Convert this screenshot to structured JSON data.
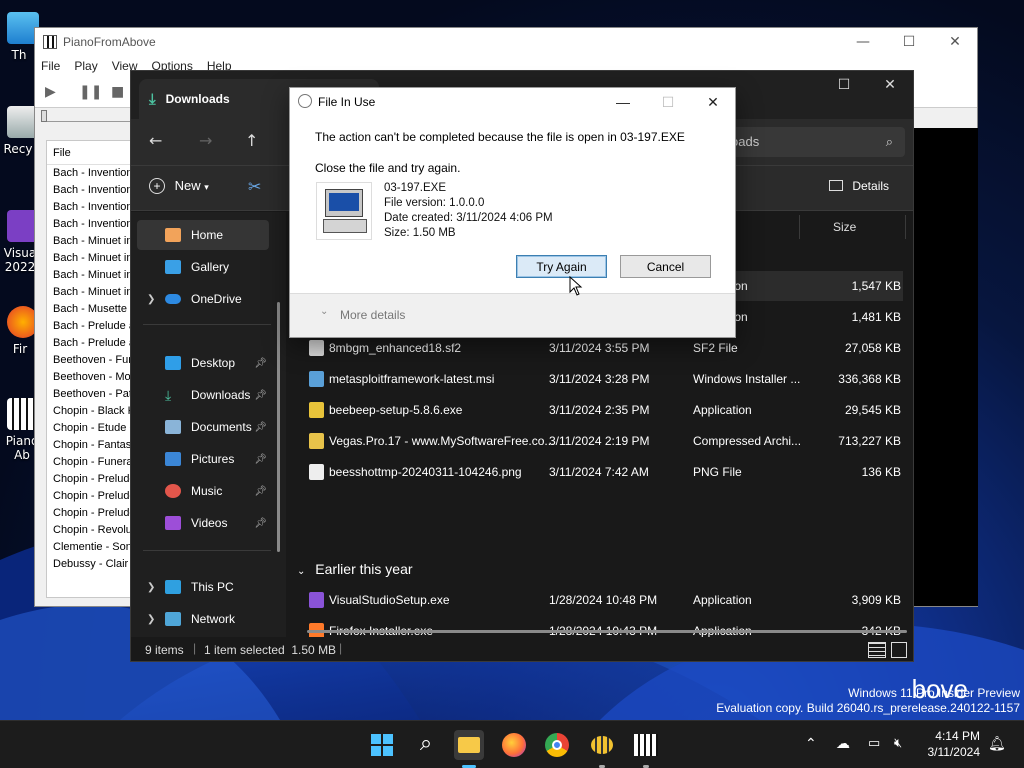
{
  "desktop": {
    "icons": [
      {
        "label": "Th",
        "icon": "this-pc-icon"
      },
      {
        "label": "Recy",
        "icon": "recycle-bin-icon"
      },
      {
        "label": "Visua\n2022",
        "icon": "visual-studio-icon"
      },
      {
        "label": "Fir",
        "icon": "firefox-icon"
      },
      {
        "label": "Piano\nAb",
        "icon": "piano-icon"
      }
    ],
    "watermark_line1": "Windows 11 Pro Insider Preview",
    "watermark_line2": "Evaluation copy. Build 26040.rs_prerelease.240122-1157"
  },
  "piano": {
    "title": "PianoFromAbove",
    "menu": [
      "File",
      "Play",
      "View",
      "Options",
      "Help"
    ],
    "list_header": "File",
    "files": [
      "Bach - Invention",
      "Bach - Invention",
      "Bach - Invention",
      "Bach - Invention",
      "Bach - Minuet in",
      "Bach - Minuet in",
      "Bach - Minuet in",
      "Bach - Minuet in",
      "Bach - Musette i",
      "Bach - Prelude a",
      "Bach - Prelude a",
      "Beethoven - Fur",
      "Beethoven - Mo",
      "Beethoven - Pat",
      "Chopin - Black K",
      "Chopin - Etude C",
      "Chopin - Fantasi",
      "Chopin - Funera",
      "Chopin - Prelude",
      "Chopin - Prelude",
      "Chopin - Prelude",
      "Chopin - Revolu",
      "Clementie - Sona",
      "Debussy - Clair c"
    ],
    "brand_text": "bove"
  },
  "explorer": {
    "tab_title": "Downloads",
    "search_placeholder": "oads",
    "new_label": "New",
    "details_label": "Details",
    "sidebar": {
      "home": "Home",
      "gallery": "Gallery",
      "onedrive": "OneDrive",
      "desktop": "Desktop",
      "downloads": "Downloads",
      "documents": "Documents",
      "pictures": "Pictures",
      "music": "Music",
      "videos": "Videos",
      "thispc": "This PC",
      "network": "Network"
    },
    "col_size": "Size",
    "rows_partial": [
      {
        "type": "ication",
        "size": "1,547 KB"
      },
      {
        "type": "ication",
        "size": "1,481 KB"
      }
    ],
    "rows": [
      {
        "name": "8mbgm_enhanced18.sf2",
        "date": "3/11/2024 3:55 PM",
        "type": "SF2 File",
        "size": "27,058 KB",
        "icon": "sf2-file-icon"
      },
      {
        "name": "metasploitframework-latest.msi",
        "date": "3/11/2024 3:28 PM",
        "type": "Windows Installer ...",
        "size": "336,368 KB",
        "icon": "msi-icon"
      },
      {
        "name": "beebeep-setup-5.8.6.exe",
        "date": "3/11/2024 2:35 PM",
        "type": "Application",
        "size": "29,545 KB",
        "icon": "beebeep-icon"
      },
      {
        "name": "Vegas.Pro.17 - www.MySoftwareFree.co...",
        "date": "3/11/2024 2:19 PM",
        "type": "Compressed Archi...",
        "size": "713,227 KB",
        "icon": "zip-folder-icon"
      },
      {
        "name": "beesshottmp-20240311-104246.png",
        "date": "3/11/2024 7:42 AM",
        "type": "PNG File",
        "size": "136 KB",
        "icon": "png-file-icon"
      }
    ],
    "group_earlier": "Earlier this year",
    "rows_earlier": [
      {
        "name": "VisualStudioSetup.exe",
        "date": "1/28/2024 10:48 PM",
        "type": "Application",
        "size": "3,909 KB",
        "icon": "visual-studio-icon"
      },
      {
        "name": "Firefox Installer.exe",
        "date": "1/28/2024 10:43 PM",
        "type": "Application",
        "size": "342 KB",
        "icon": "firefox-icon"
      }
    ],
    "status": {
      "count": "9 items",
      "selected": "1 item selected  1.50 MB"
    }
  },
  "dialog": {
    "title": "File In Use",
    "message": "The action can't be completed because the file is open in 03-197.EXE",
    "instruction": "Close the file and try again.",
    "file_name": "03-197.EXE",
    "file_version": "File version: 1.0.0.0",
    "date_created": "Date created: 3/11/2024 4:06 PM",
    "size": "Size: 1.50 MB",
    "try_again": "Try Again",
    "cancel": "Cancel",
    "more_details": "More details"
  },
  "taskbar": {
    "time": "4:14 PM",
    "date": "3/11/2024"
  }
}
